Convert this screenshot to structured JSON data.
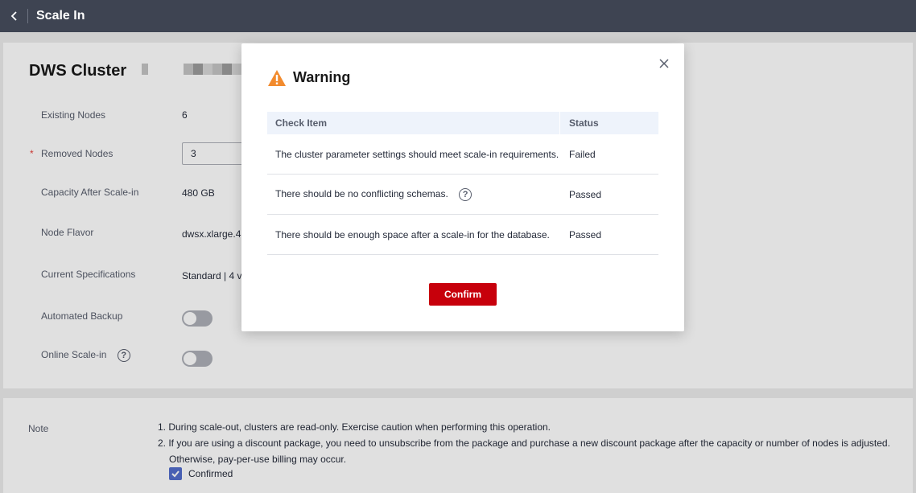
{
  "topbar": {
    "title": "Scale In"
  },
  "cluster": {
    "title": "DWS Cluster "
  },
  "form": {
    "existing_nodes_label": "Existing Nodes",
    "existing_nodes_value": "6",
    "removed_nodes_label": "Removed Nodes",
    "removed_nodes_required": "*",
    "removed_nodes_value": "3",
    "capacity_label": "Capacity After Scale-in",
    "capacity_value": "480 GB",
    "flavor_label": "Node Flavor",
    "flavor_value": "dwsx.xlarge.4",
    "spec_label": "Current Specifications",
    "spec_value": "Standard | 4 v",
    "backup_label": "Automated Backup",
    "backup_on": false,
    "online_label": "Online Scale-in",
    "online_on": false
  },
  "note": {
    "label": "Note",
    "line1": "1. During scale-out, clusters are read-only. Exercise caution when performing this operation.",
    "line2": "2. If you are using a discount package, you need to unsubscribe from the package and purchase a new discount package after the capacity or number of nodes is adjusted.",
    "line3": "Otherwise, pay-per-use billing may occur.",
    "confirmed_label": "Confirmed",
    "confirmed_checked": true
  },
  "dialog": {
    "title": "Warning",
    "col_check": "Check Item",
    "col_status": "Status",
    "rows": [
      {
        "item": "The cluster parameter settings should meet scale-in requirements.",
        "status": "Failed"
      },
      {
        "item": "There should be no conflicting schemas.",
        "status": "Passed",
        "help": "?"
      },
      {
        "item": "There should be enough space after a scale-in for the database.",
        "status": "Passed"
      }
    ],
    "confirm_label": "Confirm"
  },
  "colors": {
    "accent": "#c7000b",
    "topbar": "#3e4452",
    "warning": "#f28b2e",
    "checkbox": "#526ecc"
  },
  "icons": {
    "back": "chevron-left-icon",
    "close": "close-icon",
    "warning": "warning-triangle-icon",
    "help": "help-circle-icon",
    "check": "check-icon"
  }
}
